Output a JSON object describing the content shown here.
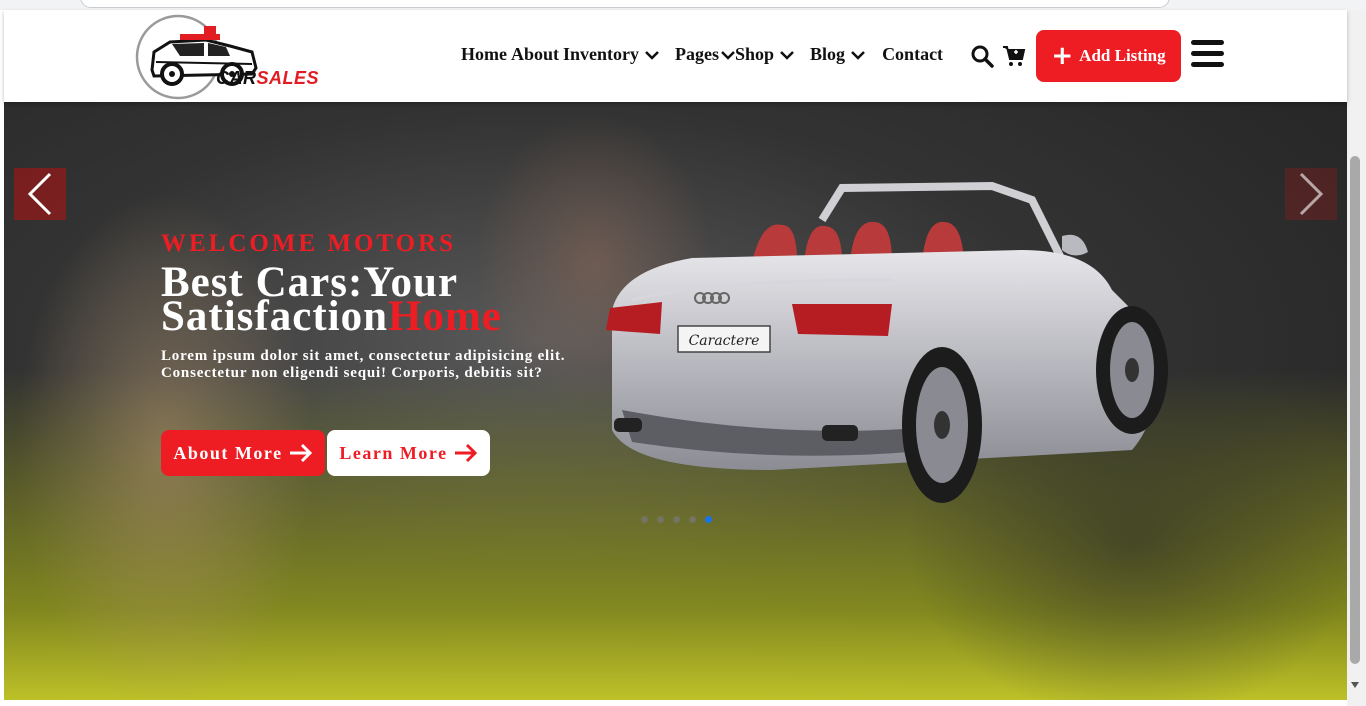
{
  "brand": {
    "logo_part1": "CAR",
    "logo_part2": "SALES"
  },
  "nav": {
    "items": [
      {
        "label": "Home",
        "dropdown": false
      },
      {
        "label": "About",
        "dropdown": false
      },
      {
        "label": "Inventory",
        "dropdown": true
      },
      {
        "label": "Pages",
        "dropdown": true
      },
      {
        "label": "Shop",
        "dropdown": true
      },
      {
        "label": "Blog",
        "dropdown": true
      },
      {
        "label": "Contact",
        "dropdown": false
      }
    ],
    "add_listing_label": "Add Listing",
    "icons": [
      "search-icon",
      "cart-icon",
      "menu-icon"
    ]
  },
  "hero": {
    "welcome": "WELCOME MOTORS",
    "title_line1": "Best Cars:Your",
    "title_line2": "Satisfaction",
    "title_highlight": "Home",
    "description": "Lorem ipsum dolor sit amet, consectetur adipisicing elit. Consectetur non eligendi sequi! Corporis, debitis sit?",
    "about_button": "About More",
    "learn_button": "Learn More",
    "plate_text": "Caractere",
    "slides_count": 5,
    "active_slide": 5
  },
  "colors": {
    "accent": "#ee1c23",
    "text_dark": "#111111",
    "active_dot": "#1a73e8"
  }
}
